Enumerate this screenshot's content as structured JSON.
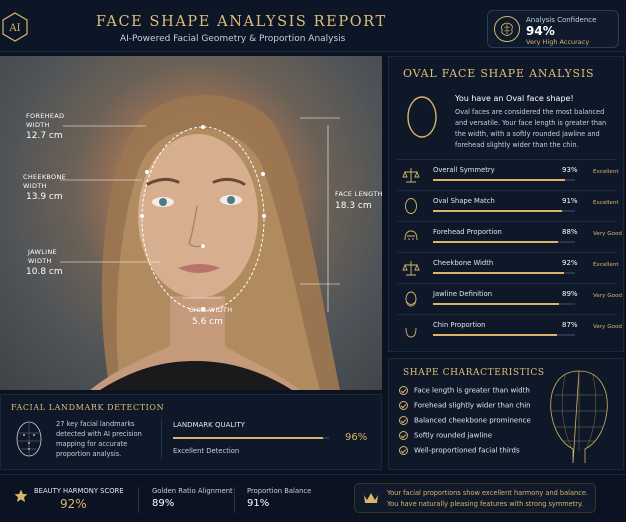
{
  "header": {
    "logo_text": "AI",
    "title": "FACE SHAPE ANALYSIS REPORT",
    "subtitle": "AI-Powered Facial Geometry & Proportion Analysis",
    "confidence": {
      "label": "Analysis Confidence",
      "value": "94%",
      "sub": "Very High Accuracy",
      "icon": "brain-icon"
    }
  },
  "photo": {
    "measurements": [
      {
        "label_lines": [
          "FOREHEAD",
          "WIDTH"
        ],
        "value": "12.7 cm"
      },
      {
        "label_lines": [
          "CHEEKBONE",
          "WIDTH"
        ],
        "value": "13.9 cm"
      },
      {
        "label_lines": [
          "JAWLINE",
          "WIDTH"
        ],
        "value": "10.8 cm"
      },
      {
        "label_lines": [
          "FACE LENGTH"
        ],
        "value": "18.3 cm"
      },
      {
        "label_lines": [
          "CHIN WIDTH"
        ],
        "value": "5.6 cm"
      }
    ]
  },
  "analysis": {
    "title": "OVAL FACE SHAPE ANALYSIS",
    "headline": "You have an Oval face shape!",
    "description": "Oval faces are considered the most balanced and versatile. Your face length is greater than the width, with a softly rounded jawline and forehead slightly wider than the chin.",
    "metrics": [
      {
        "name": "Overall Symmetry",
        "value": 93,
        "pct": "93%",
        "rating": "Excellent",
        "icon": "balance-scale-icon"
      },
      {
        "name": "Oval Shape Match",
        "value": 91,
        "pct": "91%",
        "rating": "Excellent",
        "icon": "oval-icon"
      },
      {
        "name": "Forehead Proportion",
        "value": 88,
        "pct": "88%",
        "rating": "Very Good",
        "icon": "forehead-icon"
      },
      {
        "name": "Cheekbone Width",
        "value": 92,
        "pct": "92%",
        "rating": "Excellent",
        "icon": "cheekbone-scale-icon"
      },
      {
        "name": "Jawline Definition",
        "value": 89,
        "pct": "89%",
        "rating": "Very Good",
        "icon": "jawline-icon"
      },
      {
        "name": "Chin Proportion",
        "value": 87,
        "pct": "87%",
        "rating": "Very Good",
        "icon": "chin-icon"
      }
    ]
  },
  "characteristics": {
    "title": "SHAPE CHARACTERISTICS",
    "items": [
      "Face length is greater than width",
      "Forehead slightly wider than chin",
      "Balanced cheekbone prominence",
      "Softly rounded jawline",
      "Well-proportioned facial thirds"
    ]
  },
  "landmark": {
    "title": "FACIAL LANDMARK DETECTION",
    "description": "27 key facial landmarks detected with AI precision mapping for accurate proportion analysis.",
    "quality_label": "LANDMARK QUALITY",
    "quality_value": 96,
    "quality_pct": "96%",
    "quality_sub": "Excellent Detection"
  },
  "footer": {
    "harmony_label": "BEAUTY HARMONY SCORE",
    "harmony_value": "92%",
    "golden_label": "Golden Ratio Alignment",
    "golden_value": "89%",
    "balance_label": "Proportion Balance",
    "balance_value": "91%",
    "summary_line1": "Your facial proportions show excellent harmony and balance.",
    "summary_line2": "You have naturally pleasing features with strong symmetry."
  },
  "colors": {
    "accent": "#d9b46a",
    "background": "#0b1220",
    "panel": "#0e1828"
  }
}
